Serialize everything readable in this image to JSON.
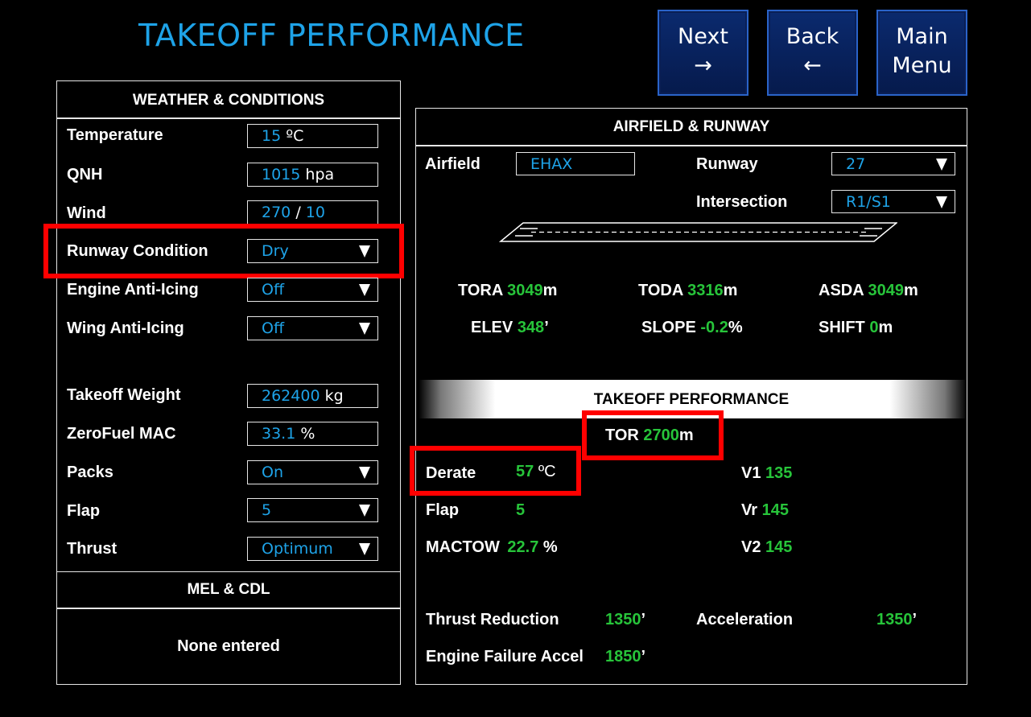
{
  "page": {
    "title": "TAKEOFF  PERFORMANCE"
  },
  "nav": {
    "next": {
      "label": "Next",
      "arrow": "→"
    },
    "back": {
      "label": "Back",
      "arrow": "←"
    },
    "main_menu": {
      "line1": "Main",
      "line2": "Menu"
    }
  },
  "weather": {
    "header": "WEATHER & CONDITIONS",
    "temperature": {
      "label": "Temperature",
      "value": "15",
      "unit": "ºC"
    },
    "qnh": {
      "label": "QNH",
      "value": "1015",
      "unit": "hpa"
    },
    "wind": {
      "label": "Wind",
      "dir": "270",
      "sep": "/",
      "speed": "10"
    },
    "runway_condition": {
      "label": "Runway Condition",
      "value": "Dry"
    },
    "engine_anti_icing": {
      "label": "Engine Anti-Icing",
      "value": "Off"
    },
    "wing_anti_icing": {
      "label": "Wing Anti-Icing",
      "value": "Off"
    },
    "takeoff_weight": {
      "label": "Takeoff Weight",
      "value": "262400",
      "unit": "kg"
    },
    "zerofuel_mac": {
      "label": "ZeroFuel MAC",
      "value": "33.1",
      "unit": "%"
    },
    "packs": {
      "label": "Packs",
      "value": "On"
    },
    "flap": {
      "label": "Flap",
      "value": "5"
    },
    "thrust": {
      "label": "Thrust",
      "value": "Optimum"
    }
  },
  "mel": {
    "header": "MEL & CDL",
    "body": "None entered"
  },
  "airfield": {
    "header": "AIRFIELD & RUNWAY",
    "airfield_label": "Airfield",
    "airfield_value": "EHAX",
    "runway_label": "Runway",
    "runway_value": "27",
    "intersection_label": "Intersection",
    "intersection_value": "R1/S1",
    "tora": {
      "label": "TORA",
      "value": "3049",
      "unit": "m"
    },
    "toda": {
      "label": "TODA",
      "value": "3316",
      "unit": "m"
    },
    "asda": {
      "label": "ASDA",
      "value": "3049",
      "unit": "m"
    },
    "elev": {
      "label": "ELEV",
      "value": "348",
      "unit": "’"
    },
    "slope": {
      "label": "SLOPE",
      "value": "-0.2",
      "unit": "%"
    },
    "shift": {
      "label": "SHIFT",
      "value": "0",
      "unit": "m"
    }
  },
  "performance": {
    "header": "TAKEOFF PERFORMANCE",
    "tor": {
      "label": "TOR",
      "value": "2700",
      "unit": "m"
    },
    "derate": {
      "label": "Derate",
      "value": "57",
      "unit": "ºC"
    },
    "flap": {
      "label": "Flap",
      "value": "5"
    },
    "mactow": {
      "label": "MACTOW",
      "value": "22.7",
      "unit": "%"
    },
    "v1": {
      "label": "V1",
      "value": "135"
    },
    "vr": {
      "label": "Vr",
      "value": "145"
    },
    "v2": {
      "label": "V2",
      "value": "145"
    },
    "thrust_reduction": {
      "label": "Thrust Reduction",
      "value": "1350",
      "unit": "’"
    },
    "acceleration": {
      "label": "Acceleration",
      "value": "1350",
      "unit": "’"
    },
    "engine_failure_accel": {
      "label": "Engine Failure Accel",
      "value": "1850",
      "unit": "’"
    }
  },
  "colors": {
    "accent_blue": "#1ea3e8",
    "value_green": "#27c43a",
    "highlight_red": "#ff0000",
    "button_blue": "#0b2a6e"
  }
}
